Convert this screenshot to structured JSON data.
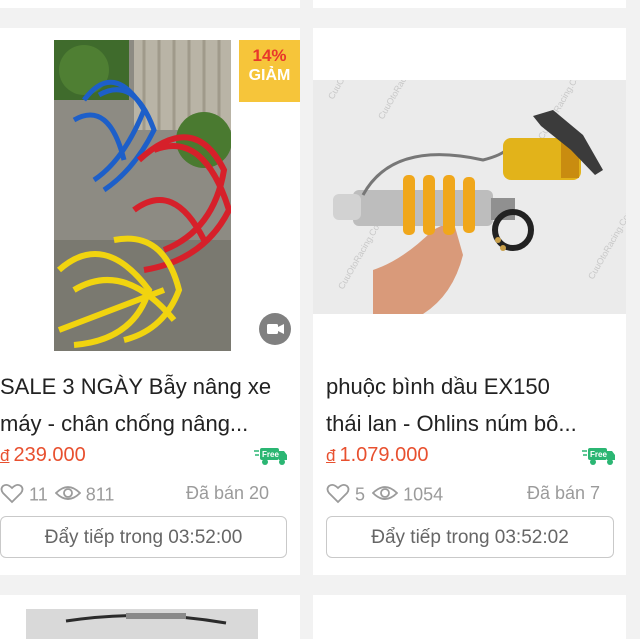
{
  "products": [
    {
      "discount_percent": "14%",
      "discount_label": "GIẢM",
      "title_line1": "SALE 3 NGÀY Bẫy nâng xe",
      "title_line2": "máy - chân chống nâng...",
      "currency": "đ",
      "price": "239.000",
      "free_label": "Free",
      "likes": "11",
      "views": "811",
      "sold": "Đã bán 20",
      "push_label": "Đẩy tiếp trong 03:52:00"
    },
    {
      "title_line1": "phuộc bình dầu EX150",
      "title_line2": "thái lan - Ohlins núm bô...",
      "currency": "đ",
      "price": "1.079.000",
      "free_label": "Free",
      "likes": "5",
      "views": "1054",
      "sold": "Đã bán 7",
      "push_label": "Đẩy tiếp trong 03:52:02"
    }
  ],
  "colors": {
    "price": "#e8502f",
    "badge": "#f6c53a",
    "free_truck": "#2bb673"
  }
}
